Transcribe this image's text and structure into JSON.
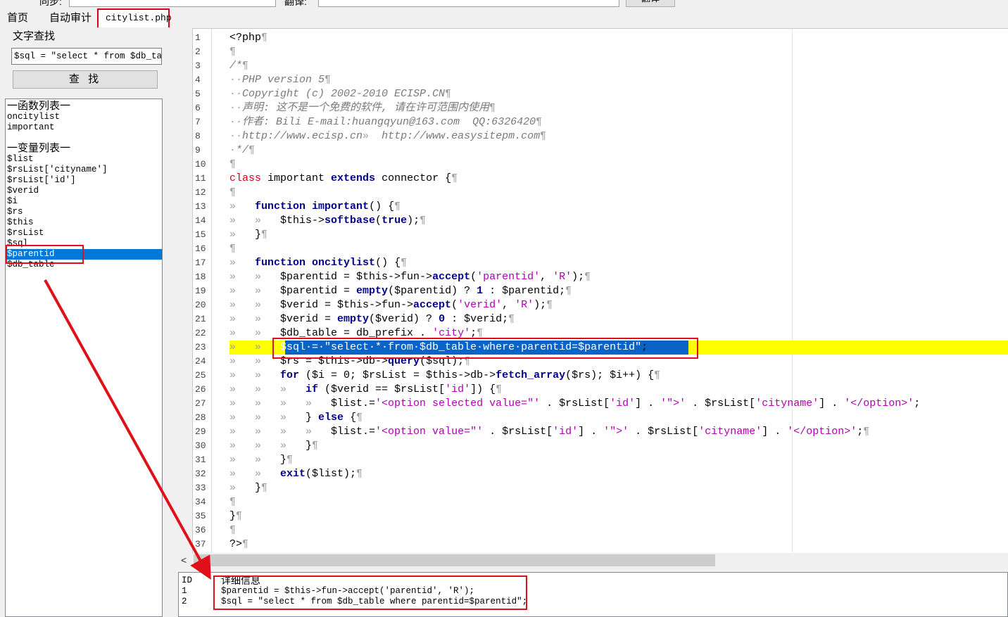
{
  "top": {
    "label1": "同步:",
    "label2": "翻译:",
    "button": "翻译"
  },
  "tabs": [
    {
      "label": "首页"
    },
    {
      "label": "自动审计"
    },
    {
      "label": "citylist.php"
    }
  ],
  "search": {
    "group_title": "文字查找",
    "input_value": "$sql = \"select * from $db_ta",
    "button_label": "查 找"
  },
  "list_panel": {
    "functions_header": "一函数列表一",
    "functions": [
      "oncitylist",
      "important"
    ],
    "variables_header": "一变量列表一",
    "variables": [
      "$list",
      "$rsList['cityname']",
      "$rsList['id']",
      "$verid",
      "$i",
      "$rs",
      "$this",
      "$rsList",
      "$sql",
      "$parentid",
      "$db_table"
    ],
    "selected": "$parentid"
  },
  "editor": {
    "line_numbers": [
      "1",
      "2",
      "3",
      "4",
      "5",
      "6",
      "7",
      "8",
      "9",
      "10",
      "11",
      "12",
      "13",
      "14",
      "15",
      "16",
      "17",
      "18",
      "19",
      "20",
      "21",
      "22",
      "23",
      "24",
      "25",
      "26",
      "27",
      "28",
      "29",
      "30",
      "31",
      "32",
      "33",
      "34",
      "35",
      "36",
      "37"
    ],
    "highlighted_line": "23",
    "lines": [
      [
        {
          "t": "<?php",
          "c": ""
        },
        {
          "t": "¶",
          "c": "w"
        }
      ],
      [
        {
          "t": "¶",
          "c": "w"
        }
      ],
      [
        {
          "t": "/*",
          "c": "cm"
        },
        {
          "t": "¶",
          "c": "w"
        }
      ],
      [
        {
          "t": "··",
          "c": "w"
        },
        {
          "t": "PHP version 5",
          "c": "cm"
        },
        {
          "t": "¶",
          "c": "w"
        }
      ],
      [
        {
          "t": "··",
          "c": "w"
        },
        {
          "t": "Copyright (c) 2002-2010 ECISP.CN",
          "c": "cm"
        },
        {
          "t": "¶",
          "c": "w"
        }
      ],
      [
        {
          "t": "··",
          "c": "w"
        },
        {
          "t": "声明: 这不是一个免费的软件, 请在许可范围内使用",
          "c": "cm"
        },
        {
          "t": "¶",
          "c": "w"
        }
      ],
      [
        {
          "t": "··",
          "c": "w"
        },
        {
          "t": "作者: Bili E-mail:huangqyun@163.com  QQ:6326420",
          "c": "cm"
        },
        {
          "t": "¶",
          "c": "w"
        }
      ],
      [
        {
          "t": "··",
          "c": "w"
        },
        {
          "t": "http://www.ecisp.cn",
          "c": "cm"
        },
        {
          "t": "»  ",
          "c": "w"
        },
        {
          "t": "http://www.easysitepm.com",
          "c": "cm"
        },
        {
          "t": "¶",
          "c": "w"
        }
      ],
      [
        {
          "t": "·",
          "c": "w"
        },
        {
          "t": "*/",
          "c": "cm"
        },
        {
          "t": "¶",
          "c": "w"
        }
      ],
      [
        {
          "t": "¶",
          "c": "w"
        }
      ],
      [
        {
          "t": "class",
          "c": "kr"
        },
        {
          "t": " important ",
          "c": ""
        },
        {
          "t": "extends",
          "c": "kw"
        },
        {
          "t": " connector ",
          "c": ""
        },
        {
          "t": "{",
          "c": ""
        },
        {
          "t": "¶",
          "c": "w"
        }
      ],
      [
        {
          "t": "¶",
          "c": "w"
        }
      ],
      [
        {
          "t": "»   ",
          "c": "w"
        },
        {
          "t": "function",
          "c": "kw"
        },
        {
          "t": " ",
          "c": ""
        },
        {
          "t": "important",
          "c": "fn"
        },
        {
          "t": "() {",
          "c": ""
        },
        {
          "t": "¶",
          "c": "w"
        }
      ],
      [
        {
          "t": "»   »   ",
          "c": "w"
        },
        {
          "t": "$this->",
          "c": ""
        },
        {
          "t": "softbase",
          "c": "fn"
        },
        {
          "t": "(",
          "c": ""
        },
        {
          "t": "true",
          "c": "kw"
        },
        {
          "t": ");",
          "c": ""
        },
        {
          "t": "¶",
          "c": "w"
        }
      ],
      [
        {
          "t": "»   ",
          "c": "w"
        },
        {
          "t": "}",
          "c": ""
        },
        {
          "t": "¶",
          "c": "w"
        }
      ],
      [
        {
          "t": "¶",
          "c": "w"
        }
      ],
      [
        {
          "t": "»   ",
          "c": "w"
        },
        {
          "t": "function",
          "c": "kw"
        },
        {
          "t": " ",
          "c": ""
        },
        {
          "t": "oncitylist",
          "c": "fn"
        },
        {
          "t": "() {",
          "c": ""
        },
        {
          "t": "¶",
          "c": "w"
        }
      ],
      [
        {
          "t": "»   »   ",
          "c": "w"
        },
        {
          "t": "$parentid = $this->fun->",
          "c": ""
        },
        {
          "t": "accept",
          "c": "fn"
        },
        {
          "t": "(",
          "c": ""
        },
        {
          "t": "'parentid'",
          "c": "st"
        },
        {
          "t": ", ",
          "c": ""
        },
        {
          "t": "'R'",
          "c": "st"
        },
        {
          "t": ");",
          "c": ""
        },
        {
          "t": "¶",
          "c": "w"
        }
      ],
      [
        {
          "t": "»   »   ",
          "c": "w"
        },
        {
          "t": "$parentid = ",
          "c": ""
        },
        {
          "t": "empty",
          "c": "fn"
        },
        {
          "t": "($parentid) ? ",
          "c": ""
        },
        {
          "t": "1",
          "c": "kw"
        },
        {
          "t": " : $parentid;",
          "c": ""
        },
        {
          "t": "¶",
          "c": "w"
        }
      ],
      [
        {
          "t": "»   »   ",
          "c": "w"
        },
        {
          "t": "$verid = $this->fun->",
          "c": ""
        },
        {
          "t": "accept",
          "c": "fn"
        },
        {
          "t": "(",
          "c": ""
        },
        {
          "t": "'verid'",
          "c": "st"
        },
        {
          "t": ", ",
          "c": ""
        },
        {
          "t": "'R'",
          "c": "st"
        },
        {
          "t": ");",
          "c": ""
        },
        {
          "t": "¶",
          "c": "w"
        }
      ],
      [
        {
          "t": "»   »   ",
          "c": "w"
        },
        {
          "t": "$verid = ",
          "c": ""
        },
        {
          "t": "empty",
          "c": "fn"
        },
        {
          "t": "($verid) ? ",
          "c": ""
        },
        {
          "t": "0",
          "c": "kw"
        },
        {
          "t": " : $verid;",
          "c": ""
        },
        {
          "t": "¶",
          "c": "w"
        }
      ],
      [
        {
          "t": "»   »   ",
          "c": "w"
        },
        {
          "t": "$db_table = db_prefix . ",
          "c": ""
        },
        {
          "t": "'city'",
          "c": "st"
        },
        {
          "t": ";",
          "c": ""
        },
        {
          "t": "¶",
          "c": "w"
        }
      ],
      [
        {
          "t": "»   »   ",
          "c": "w"
        },
        {
          "t": "$sql·=·\"select·*·from·$db_table·where·parentid=$parentid\"",
          "c": "sel"
        },
        {
          "t": ";",
          "c": ""
        }
      ],
      [
        {
          "t": "»   »   ",
          "c": "w"
        },
        {
          "t": "$rs = $this->db->",
          "c": ""
        },
        {
          "t": "query",
          "c": "fn"
        },
        {
          "t": "($sql);",
          "c": ""
        },
        {
          "t": "¶",
          "c": "w"
        }
      ],
      [
        {
          "t": "»   »   ",
          "c": "w"
        },
        {
          "t": "for",
          "c": "kw"
        },
        {
          "t": " ($i = 0; $rsList = $this->db->",
          "c": ""
        },
        {
          "t": "fetch_array",
          "c": "fn"
        },
        {
          "t": "($rs); $i++) {",
          "c": ""
        },
        {
          "t": "¶",
          "c": "w"
        }
      ],
      [
        {
          "t": "»   »   »   ",
          "c": "w"
        },
        {
          "t": "if",
          "c": "kw"
        },
        {
          "t": " ($verid == $rsList[",
          "c": ""
        },
        {
          "t": "'id'",
          "c": "st"
        },
        {
          "t": "]) {",
          "c": ""
        },
        {
          "t": "¶",
          "c": "w"
        }
      ],
      [
        {
          "t": "»   »   »   »   ",
          "c": "w"
        },
        {
          "t": "$list.=",
          "c": ""
        },
        {
          "t": "'<option selected value=\"'",
          "c": "st"
        },
        {
          "t": " . $rsList[",
          "c": ""
        },
        {
          "t": "'id'",
          "c": "st"
        },
        {
          "t": "] . ",
          "c": ""
        },
        {
          "t": "'\">'",
          "c": "st"
        },
        {
          "t": " . $rsList[",
          "c": ""
        },
        {
          "t": "'cityname'",
          "c": "st"
        },
        {
          "t": "] . ",
          "c": ""
        },
        {
          "t": "'</option>'",
          "c": "st"
        },
        {
          "t": ";",
          "c": ""
        }
      ],
      [
        {
          "t": "»   »   »   ",
          "c": "w"
        },
        {
          "t": "} ",
          "c": ""
        },
        {
          "t": "else",
          "c": "kw"
        },
        {
          "t": " {",
          "c": ""
        },
        {
          "t": "¶",
          "c": "w"
        }
      ],
      [
        {
          "t": "»   »   »   »   ",
          "c": "w"
        },
        {
          "t": "$list.=",
          "c": ""
        },
        {
          "t": "'<option value=\"'",
          "c": "st"
        },
        {
          "t": " . $rsList[",
          "c": ""
        },
        {
          "t": "'id'",
          "c": "st"
        },
        {
          "t": "] . ",
          "c": ""
        },
        {
          "t": "'\">'",
          "c": "st"
        },
        {
          "t": " . $rsList[",
          "c": ""
        },
        {
          "t": "'cityname'",
          "c": "st"
        },
        {
          "t": "] . ",
          "c": ""
        },
        {
          "t": "'</option>'",
          "c": "st"
        },
        {
          "t": ";",
          "c": ""
        },
        {
          "t": "¶",
          "c": "w"
        }
      ],
      [
        {
          "t": "»   »   »   ",
          "c": "w"
        },
        {
          "t": "}",
          "c": ""
        },
        {
          "t": "¶",
          "c": "w"
        }
      ],
      [
        {
          "t": "»   »   ",
          "c": "w"
        },
        {
          "t": "}",
          "c": ""
        },
        {
          "t": "¶",
          "c": "w"
        }
      ],
      [
        {
          "t": "»   »   ",
          "c": "w"
        },
        {
          "t": "exit",
          "c": "fn"
        },
        {
          "t": "($list);",
          "c": ""
        },
        {
          "t": "¶",
          "c": "w"
        }
      ],
      [
        {
          "t": "»   ",
          "c": "w"
        },
        {
          "t": "}",
          "c": ""
        },
        {
          "t": "¶",
          "c": "w"
        }
      ],
      [
        {
          "t": "¶",
          "c": "w"
        }
      ],
      [
        {
          "t": "}",
          "c": ""
        },
        {
          "t": "¶",
          "c": "w"
        }
      ],
      [
        {
          "t": "¶",
          "c": "w"
        }
      ],
      [
        {
          "t": "?>",
          "c": ""
        },
        {
          "t": "¶",
          "c": "w"
        }
      ]
    ]
  },
  "scrollbar": {
    "left_arrow": "<"
  },
  "detail": {
    "id_header": "ID",
    "title": "详细信息",
    "rows": [
      {
        "id": "1",
        "text": "$parentid = $this->fun->accept('parentid', 'R');"
      },
      {
        "id": "2",
        "text": "$sql = \"select * from $db_table where parentid=$parentid\";"
      }
    ]
  },
  "colors": {
    "selection": "#0078d7",
    "highlight_line": "#ffff00",
    "annotation": "#e0101a"
  }
}
